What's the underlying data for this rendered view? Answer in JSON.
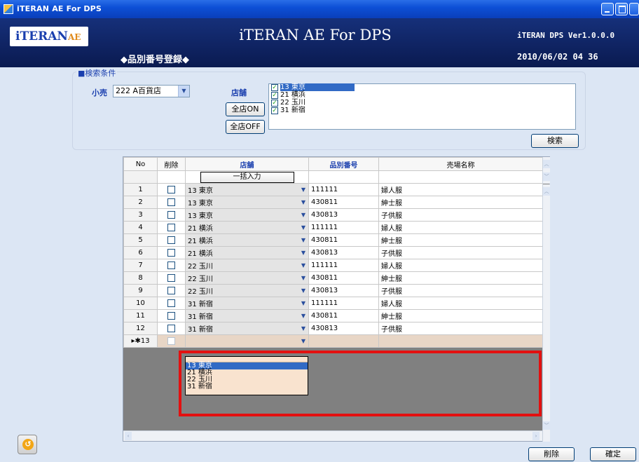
{
  "window": {
    "title": "iTERAN AE For DPS"
  },
  "header": {
    "logo": "iTERAN",
    "logo_suffix": "AE",
    "app_title": "iTERAN AE For DPS",
    "screen_name": "◆品別番号登録◆",
    "version": "iTERAN DPS Ver1.0.0.0",
    "datetime": "2010/06/02 04 36"
  },
  "search": {
    "legend": "■検索条件",
    "retail_label": "小売",
    "retail_value": "222  A百貨店",
    "store_label": "店舗",
    "all_on": "全店ON",
    "all_off": "全店OFF",
    "stores": [
      {
        "label": "13 東京",
        "checked": true,
        "selected": true
      },
      {
        "label": "21 横浜",
        "checked": true,
        "selected": false
      },
      {
        "label": "22 玉川",
        "checked": true,
        "selected": false
      },
      {
        "label": "31 新宿",
        "checked": true,
        "selected": false
      }
    ],
    "search_button": "検索"
  },
  "grid": {
    "columns": [
      "No",
      "削除",
      "店舗",
      "品別番号",
      "売場名称"
    ],
    "bulk_input": "一括入力",
    "rows": [
      {
        "no": "1",
        "store": "13 東京",
        "code": "111111",
        "name": "婦人服"
      },
      {
        "no": "2",
        "store": "13 東京",
        "code": "430811",
        "name": "紳士服"
      },
      {
        "no": "3",
        "store": "13 東京",
        "code": "430813",
        "name": "子供服"
      },
      {
        "no": "4",
        "store": "21 横浜",
        "code": "111111",
        "name": "婦人服"
      },
      {
        "no": "5",
        "store": "21 横浜",
        "code": "430811",
        "name": "紳士服"
      },
      {
        "no": "6",
        "store": "21 横浜",
        "code": "430813",
        "name": "子供服"
      },
      {
        "no": "7",
        "store": "22 玉川",
        "code": "111111",
        "name": "婦人服"
      },
      {
        "no": "8",
        "store": "22 玉川",
        "code": "430811",
        "name": "紳士服"
      },
      {
        "no": "9",
        "store": "22 玉川",
        "code": "430813",
        "name": "子供服"
      },
      {
        "no": "10",
        "store": "31 新宿",
        "code": "111111",
        "name": "婦人服"
      },
      {
        "no": "11",
        "store": "31 新宿",
        "code": "430811",
        "name": "紳士服"
      },
      {
        "no": "12",
        "store": "31 新宿",
        "code": "430813",
        "name": "子供服"
      }
    ],
    "new_row_marker": "▸✱13"
  },
  "dropdown": {
    "options": [
      "13 東京",
      "21 横浜",
      "22 玉川",
      "31 新宿"
    ],
    "selected_index": 0
  },
  "footer": {
    "delete_button": "削除",
    "confirm_button": "確定"
  },
  "colors": {
    "title_bar": "#0d4fd6",
    "header_bg": "#0a1a50",
    "label_blue": "#1a3fae",
    "highlight_red": "#e31010",
    "selection_blue": "#316ac5"
  }
}
